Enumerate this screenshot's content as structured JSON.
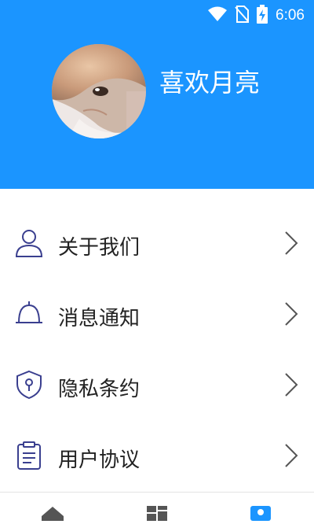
{
  "status": {
    "time": "6:06"
  },
  "profile": {
    "name": "喜欢月亮"
  },
  "menu": [
    {
      "label": "关于我们",
      "icon": "user-icon"
    },
    {
      "label": "消息通知",
      "icon": "bell-icon"
    },
    {
      "label": "隐私条约",
      "icon": "shield-icon"
    },
    {
      "label": "用户协议",
      "icon": "clipboard-icon"
    }
  ],
  "colors": {
    "header": "#1b95ff",
    "icon_stroke": "#3a3f8f",
    "active_tab": "#1b95ff"
  },
  "tabs": [
    {
      "icon": "home-icon",
      "active": false
    },
    {
      "icon": "grid-icon",
      "active": false
    },
    {
      "icon": "profile-icon",
      "active": true
    }
  ]
}
